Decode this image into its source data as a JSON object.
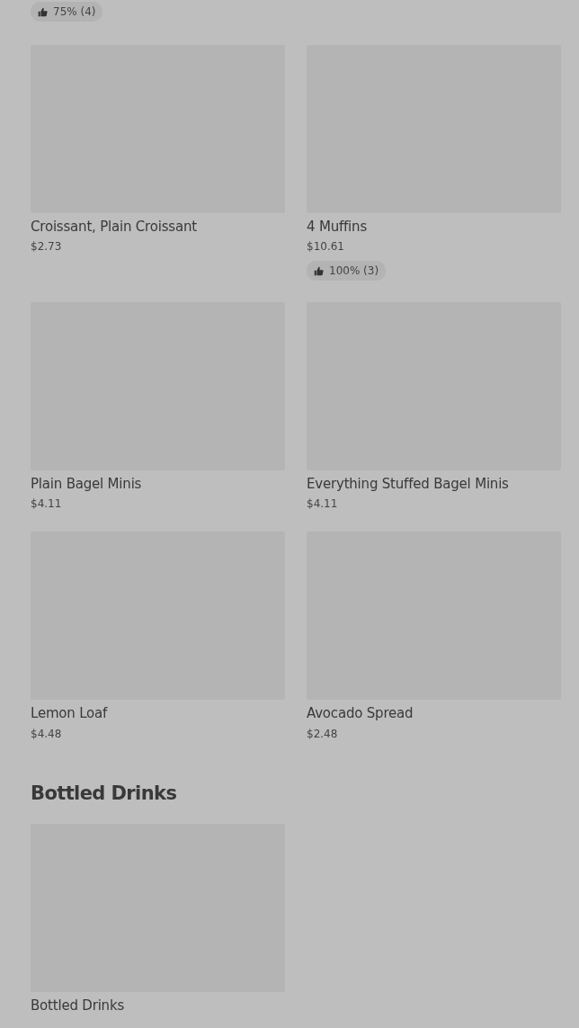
{
  "top_rating": {
    "rating": "75% (4)"
  },
  "items": [
    {
      "name": "Croissant, Plain Croissant",
      "price": "$2.73"
    },
    {
      "name": "4 Muffins",
      "price": "$10.61",
      "rating": "100% (3)"
    },
    {
      "name": "Plain Bagel Minis",
      "price": "$4.11"
    },
    {
      "name": "Everything Stuffed Bagel Minis",
      "price": "$4.11"
    },
    {
      "name": "Lemon Loaf",
      "price": "$4.48"
    },
    {
      "name": "Avocado Spread",
      "price": "$2.48"
    }
  ],
  "sections": [
    {
      "title": "Bottled Drinks",
      "items": [
        {
          "name": "Bottled Drinks"
        }
      ]
    }
  ]
}
